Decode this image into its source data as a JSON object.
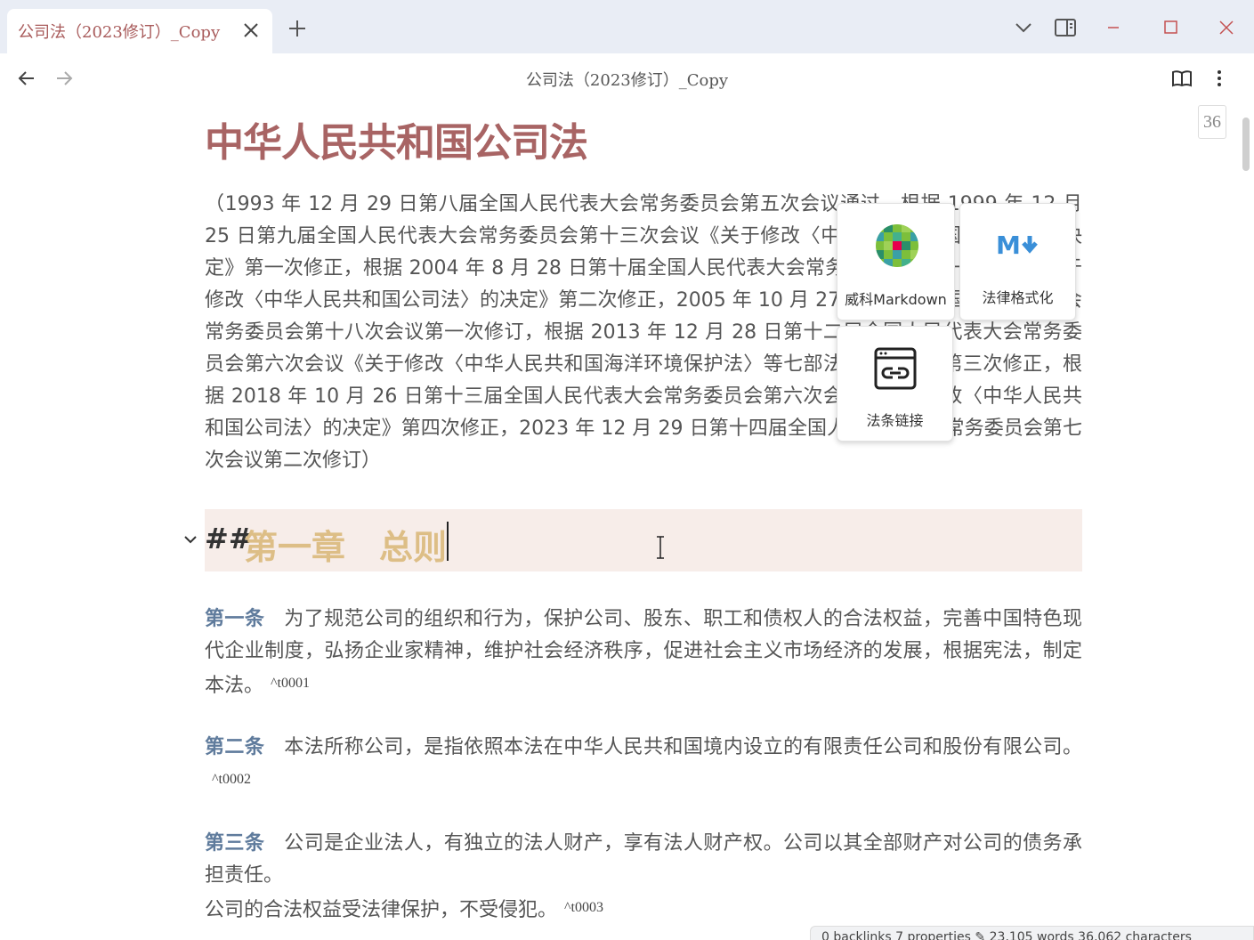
{
  "tab": {
    "title": "公司法（2023修订）_Copy"
  },
  "nav": {
    "title": "公司法（2023修订）_Copy"
  },
  "icons": {
    "tab_close": "close-icon",
    "new_tab": "plus-icon",
    "tab_list": "chevron-down-icon",
    "sidebar_toggle": "sidebar-icon",
    "minimize": "minimize-icon",
    "maximize": "maximize-icon",
    "close_window": "close-icon",
    "back": "arrow-left-icon",
    "forward": "arrow-right-icon",
    "reading_view": "book-open-icon",
    "more": "more-vertical-icon"
  },
  "document": {
    "title": "中华人民共和国公司法",
    "preamble": "（1993 年 12 月 29 日第八届全国人民代表大会常务委员会第五次会议通过，根据 1999 年 12 月 25 日第九届全国人民代表大会常务委员会第十三次会议《关于修改〈中华人民共和国公司法〉的决定》第一次修正，根据 2004 年 8 月 28 日第十届全国人民代表大会常务委员会第十一次会议《关于修改〈中华人民共和国公司法〉的决定》第二次修正，2005 年 10 月 27 日第十届全国人民代表大会常务委员会第十八次会议第一次修订，根据 2013 年 12 月 28 日第十二届全国人民代表大会常务委员会第六次会议《关于修改〈中华人民共和国海洋环境保护法〉等七部法律的决定》第三次修正，根据 2018 年 10 月 26 日第十三届全国人民代表大会常务委员会第六次会议《关于修改〈中华人民共和国公司法〉的决定》第四次修正，2023 年 12 月 29 日第十四届全国人民代表大会常务委员会第七次会议第二次修订）",
    "heading_marker": "##",
    "heading_text": "第一章　总则",
    "articles": [
      {
        "label": "第一条",
        "text": "为了规范公司的组织和行为，保护公司、股东、职工和债权人的合法权益，完善中国特色现代企业制度，弘扬企业家精神，维护社会经济秩序，促进社会主义市场经济的发展，根据宪法，制定本法。",
        "ref": "^t0001"
      },
      {
        "label": "第二条",
        "text": "本法所称公司，是指依照本法在中华人民共和国境内设立的有限责任公司和股份有限公司。",
        "ref": "^t0002"
      },
      {
        "label": "第三条",
        "text": "公司是企业法人，有独立的法人财产，享有法人财产权。公司以其全部财产对公司的债务承担责任。",
        "text2": "公司的合法权益受法律保护，不受侵犯。",
        "ref": "^t0003"
      }
    ]
  },
  "page_indicator": "36",
  "plugins": [
    {
      "label": "威科Markdown",
      "icon": "wolters-kluwer-logo-icon"
    },
    {
      "label": "法律格式化",
      "icon": "markdown-icon",
      "icon_text": "M"
    },
    {
      "label": "法条链接",
      "icon": "link-window-icon"
    }
  ],
  "statusbar": {
    "text": "0 backlinks   7 properties   ✎   23,105 words   36,062 characters"
  },
  "colors": {
    "title": "#a86464",
    "heading": "#ddbe86",
    "article_label": "#5f7b9c",
    "heading_bg": "#f7ede9",
    "markdown_icon": "#3a8fd8"
  }
}
